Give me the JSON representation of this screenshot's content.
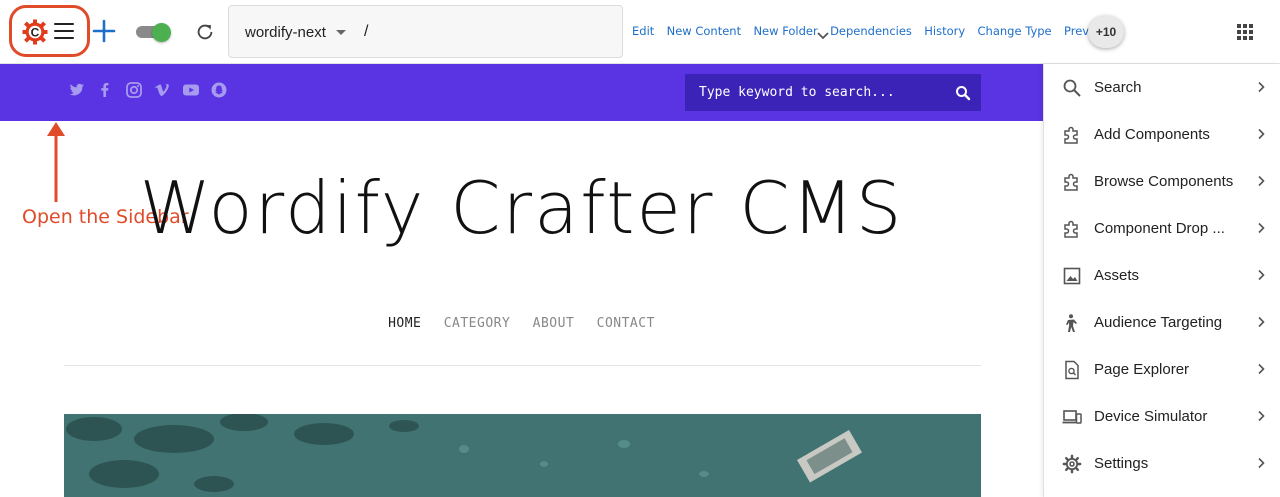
{
  "toolbar": {
    "site_name": "wordify-next",
    "path": "/",
    "actions": [
      "Edit",
      "New Content",
      "New Folder",
      "Dependencies",
      "History",
      "Change Type",
      "Preview"
    ],
    "more_count": "+10",
    "logo_letter": "C",
    "accent_color": "#1e6fc9",
    "toggle_color": "#4caf50"
  },
  "annotation": {
    "label": "Open the Sidebar",
    "color": "#e04b2a"
  },
  "preview": {
    "search_placeholder": "Type keyword to search...",
    "social_icons": [
      "twitter-icon",
      "facebook-icon",
      "instagram-icon",
      "vimeo-icon",
      "youtube-icon",
      "snapchat-icon"
    ],
    "bar_color": "#5a33e2",
    "site_title": "Wordify Crafter CMS",
    "nav": [
      {
        "label": "HOME",
        "active": true
      },
      {
        "label": "CATEGORY",
        "active": false
      },
      {
        "label": "ABOUT",
        "active": false
      },
      {
        "label": "CONTACT",
        "active": false
      }
    ]
  },
  "sidebar": {
    "items": [
      {
        "label": "Search",
        "icon": "search-icon"
      },
      {
        "label": "Add Components",
        "icon": "puzzle-icon"
      },
      {
        "label": "Browse Components",
        "icon": "puzzle-icon"
      },
      {
        "label": "Component Drop ...",
        "icon": "puzzle-icon"
      },
      {
        "label": "Assets",
        "icon": "image-icon"
      },
      {
        "label": "Audience Targeting",
        "icon": "person-icon"
      },
      {
        "label": "Page Explorer",
        "icon": "page-search-icon"
      },
      {
        "label": "Device Simulator",
        "icon": "devices-icon"
      },
      {
        "label": "Settings",
        "icon": "gear-icon"
      }
    ]
  }
}
